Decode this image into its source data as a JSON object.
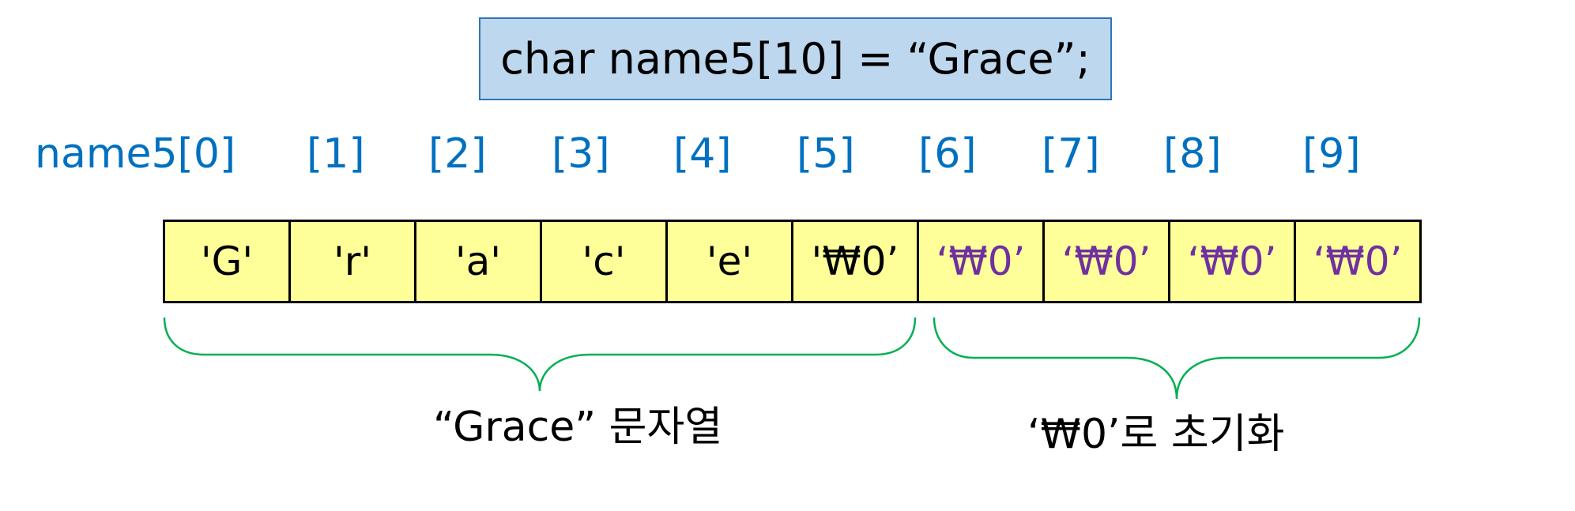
{
  "code": "char name5[10] = “Grace”;",
  "index_labels": [
    "name5[0]",
    "[1]",
    "[2]",
    "[3]",
    "[4]",
    "[5]",
    "[6]",
    "[7]",
    "[8]",
    "[9]"
  ],
  "cells": [
    {
      "text": "'G'",
      "kind": "str"
    },
    {
      "text": "'r'",
      "kind": "str"
    },
    {
      "text": "'a'",
      "kind": "str"
    },
    {
      "text": "'c'",
      "kind": "str"
    },
    {
      "text": "'e'",
      "kind": "str"
    },
    {
      "text": "'₩0’",
      "kind": "str"
    },
    {
      "text": "‘₩0’",
      "kind": "fill"
    },
    {
      "text": "‘₩0’",
      "kind": "fill"
    },
    {
      "text": "‘₩0’",
      "kind": "fill"
    },
    {
      "text": "‘₩0’",
      "kind": "fill"
    }
  ],
  "braces": {
    "string_label": "“Grace” 문자열",
    "fill_label": "‘₩0’로 초기화"
  },
  "colors": {
    "index_text": "#0070c0",
    "cell_fill": "#ffff99",
    "code_box_fill": "#bdd7ee",
    "code_box_border": "#2e75b6",
    "null_char_text": "#7030a0",
    "brace_stroke": "#00b050"
  }
}
